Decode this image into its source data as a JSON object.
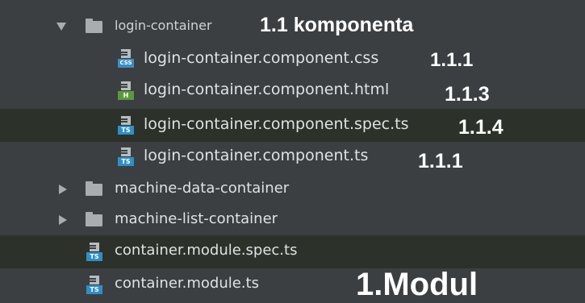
{
  "tree": {
    "items": [
      {
        "label": "login-container",
        "kind": "folder",
        "expanded": true,
        "annotation": "1.1 komponenta"
      },
      {
        "label": "login-container.component.css",
        "kind": "file",
        "icon": "css-file-icon",
        "badge": "CSS",
        "badge_color": "#3a8fc4",
        "annotation": "1.1.1"
      },
      {
        "label": "login-container.component.html",
        "kind": "file",
        "icon": "html-file-icon",
        "badge": "H",
        "badge_color": "#5a9a3c",
        "annotation": "1.1.3"
      },
      {
        "label": "login-container.component.spec.ts",
        "kind": "file",
        "icon": "ts-file-icon",
        "badge": "TS",
        "badge_color": "#2f8fc9",
        "annotation": "1.1.4",
        "highlighted": true
      },
      {
        "label": "login-container.component.ts",
        "kind": "file",
        "icon": "ts-file-icon",
        "badge": "TS",
        "badge_color": "#2f8fc9",
        "annotation": "1.1.1"
      },
      {
        "label": "machine-data-container",
        "kind": "folder",
        "expanded": false
      },
      {
        "label": "machine-list-container",
        "kind": "folder",
        "expanded": false
      },
      {
        "label": "container.module.spec.ts",
        "kind": "file",
        "icon": "ts-file-icon",
        "badge": "TS",
        "badge_color": "#2f8fc9",
        "highlighted": true
      },
      {
        "label": "container.module.ts",
        "kind": "file",
        "icon": "ts-file-icon",
        "badge": "TS",
        "badge_color": "#2f8fc9",
        "annotation": "1.Modul"
      }
    ]
  },
  "colors": {
    "background": "#3c3f41",
    "highlight_row": "#2c3229",
    "text": "#dfe1e3",
    "annotation": "#ffffff"
  }
}
